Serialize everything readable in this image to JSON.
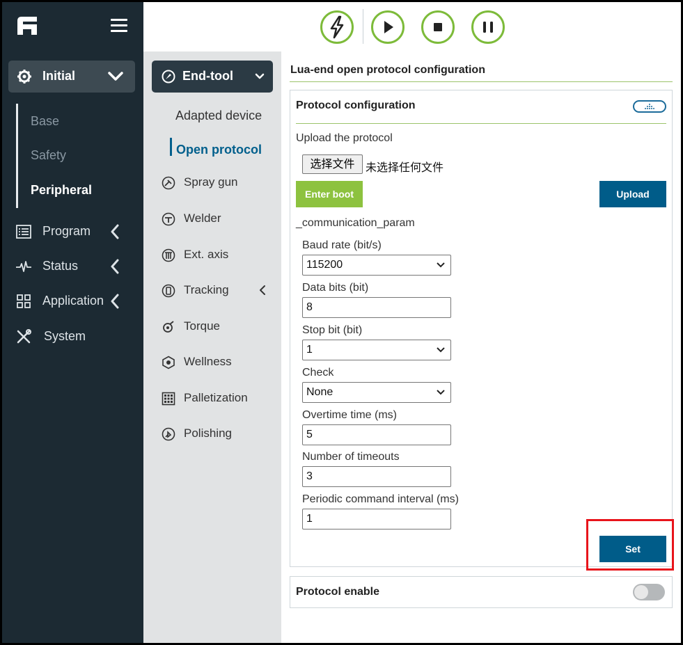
{
  "sidebar": {
    "initial_label": "Initial",
    "sub_items": [
      {
        "label": "Base"
      },
      {
        "label": "Safety"
      },
      {
        "label": "Peripheral"
      }
    ],
    "nav_items": [
      {
        "label": "Program",
        "icon": "list-icon"
      },
      {
        "label": "Status",
        "icon": "pulse-icon"
      },
      {
        "label": "Application",
        "icon": "grid-icon"
      },
      {
        "label": "System",
        "icon": "tools-icon"
      }
    ]
  },
  "toolbar": {
    "buttons": [
      "lightning-icon",
      "play-icon",
      "stop-icon",
      "pause-icon"
    ]
  },
  "col2": {
    "endtool_label": "End-tool",
    "items": [
      {
        "label": "Adapted device"
      },
      {
        "label": "Open protocol"
      },
      {
        "label": "Spray gun"
      },
      {
        "label": "Welder"
      },
      {
        "label": "Ext. axis"
      },
      {
        "label": "Tracking"
      },
      {
        "label": "Torque"
      },
      {
        "label": "Wellness"
      },
      {
        "label": "Palletization"
      },
      {
        "label": "Polishing"
      }
    ]
  },
  "main": {
    "title": "Lua-end open protocol configuration",
    "protocol_config": {
      "title": "Protocol configuration",
      "upload_label": "Upload the protocol",
      "file_button": "选择文件",
      "file_status": "未选择任何文件",
      "enter_boot": "Enter boot",
      "upload": "Upload",
      "comm_label": "_communication_param",
      "fields": [
        {
          "label": "Baud rate (bit/s)",
          "value": "115200",
          "type": "select"
        },
        {
          "label": "Data bits (bit)",
          "value": "8",
          "type": "input"
        },
        {
          "label": "Stop bit (bit)",
          "value": "1",
          "type": "select"
        },
        {
          "label": "Check",
          "value": "None",
          "type": "select"
        },
        {
          "label": "Overtime time (ms)",
          "value": "5",
          "type": "input"
        },
        {
          "label": "Number of timeouts",
          "value": "3",
          "type": "input"
        },
        {
          "label": "Periodic command interval (ms)",
          "value": "1",
          "type": "input"
        }
      ],
      "set": "Set"
    },
    "protocol_enable": {
      "title": "Protocol enable",
      "enabled": false
    }
  },
  "colors": {
    "sidebar_bg": "#1c2a33",
    "accent_green": "#8dc23f",
    "primary_blue": "#005c89",
    "highlight_red": "#e8141b"
  }
}
